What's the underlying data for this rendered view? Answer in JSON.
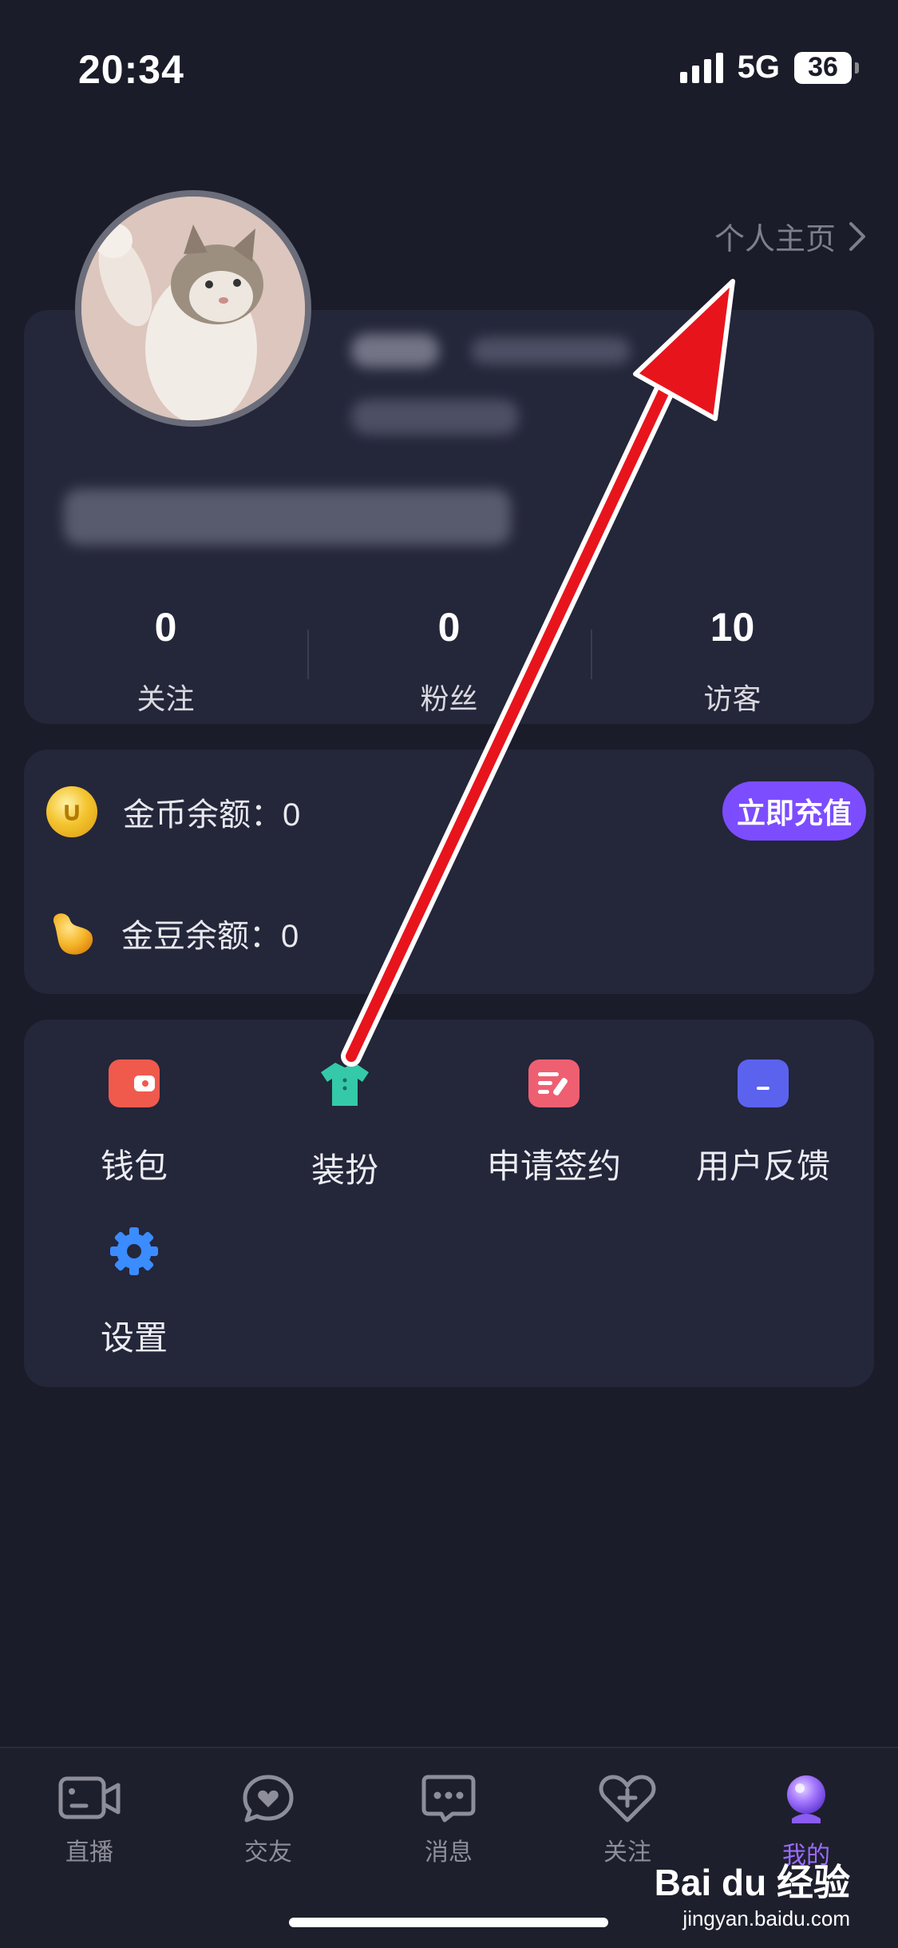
{
  "status_bar": {
    "time": "20:34",
    "network": "5G",
    "battery": "36"
  },
  "profile": {
    "homepage_link": "个人主页",
    "stats": [
      {
        "value": "0",
        "label": "关注"
      },
      {
        "value": "0",
        "label": "粉丝"
      },
      {
        "value": "10",
        "label": "访客"
      }
    ]
  },
  "balance": {
    "gold_coin": {
      "label": "金币余额：",
      "value": "0"
    },
    "gold_bean": {
      "label": "金豆余额：",
      "value": "0"
    },
    "recharge_button": "立即充值"
  },
  "tools": [
    {
      "label": "钱包",
      "icon": "wallet-icon",
      "color": "#ef5a4d"
    },
    {
      "label": "装扮",
      "icon": "tshirt-icon",
      "color": "#34c9a8"
    },
    {
      "label": "申请签约",
      "icon": "sign-contract-icon",
      "color": "#ef5f72"
    },
    {
      "label": "用户反馈",
      "icon": "feedback-icon",
      "color": "#5b62ee"
    },
    {
      "label": "设置",
      "icon": "gear-icon",
      "color": "#3b8cff"
    }
  ],
  "tabbar": [
    {
      "label": "直播",
      "icon": "live-camera-icon"
    },
    {
      "label": "交友",
      "icon": "heart-chat-icon"
    },
    {
      "label": "消息",
      "icon": "message-icon"
    },
    {
      "label": "关注",
      "icon": "heart-plus-icon"
    },
    {
      "label": "我的",
      "icon": "profile-bulb-icon",
      "active": true
    }
  ],
  "colors": {
    "background": "#1b1c2a",
    "card": "#24263a",
    "accent": "#7c4dff",
    "active_tab": "#9a6bff",
    "annotation_arrow": "#e8141c"
  },
  "watermark": {
    "brand": "Bai du 经验",
    "url": "jingyan.baidu.com"
  }
}
